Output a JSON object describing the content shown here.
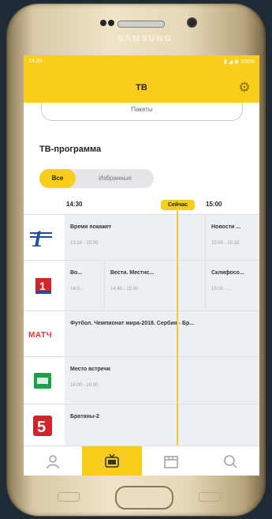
{
  "device": {
    "brand": "SAMSUNG"
  },
  "statusbar": {
    "time": "14:30",
    "icons": "▮ ◢ ◉ 100%"
  },
  "header": {
    "title": "ТВ"
  },
  "packages": {
    "label": "Пакеты"
  },
  "section": {
    "title": "ТВ-программа"
  },
  "tabs": {
    "all": "Все",
    "favorites": "Избранные"
  },
  "timeline": {
    "t1": "14:30",
    "now": "Сейчас",
    "t2": "15:00"
  },
  "channels": [
    {
      "name": "Первый канал",
      "logo_icon": "channel-1-icon",
      "programs": [
        {
          "title": "Время покажет",
          "time": "13:10 - 15:00"
        },
        {
          "title": "Новости ...",
          "time": "15:00 - 15:15"
        }
      ]
    },
    {
      "name": "Россия 1",
      "logo_icon": "russia-1-icon",
      "programs": [
        {
          "title": "Во...",
          "time": "14:0..."
        },
        {
          "title": "Вести. Местнс...",
          "time": "14:40 - 15:00"
        },
        {
          "title": "Склифосо...",
          "time": "15:00 - ..."
        }
      ]
    },
    {
      "name": "Матч ТВ",
      "logo_icon": "match-tv-icon",
      "programs": [
        {
          "title": "Футбол. Чемпионат мира-2018. Сербия - Бр...",
          "time": ""
        }
      ]
    },
    {
      "name": "НТВ",
      "logo_icon": "ntv-icon",
      "programs": [
        {
          "title": "Место встречи",
          "time": "14:00 - 16:00"
        }
      ]
    },
    {
      "name": "Пятый канал",
      "logo_icon": "channel-5-icon",
      "programs": [
        {
          "title": "Братаны-2",
          "time": ""
        }
      ]
    }
  ],
  "colors": {
    "accent": "#f8cd1c",
    "grid_bg": "#eceff3"
  },
  "nav": {
    "profile_icon": "user-icon",
    "tv_icon": "tv-icon",
    "cinema_icon": "clapperboard-icon",
    "search_icon": "search-icon"
  }
}
